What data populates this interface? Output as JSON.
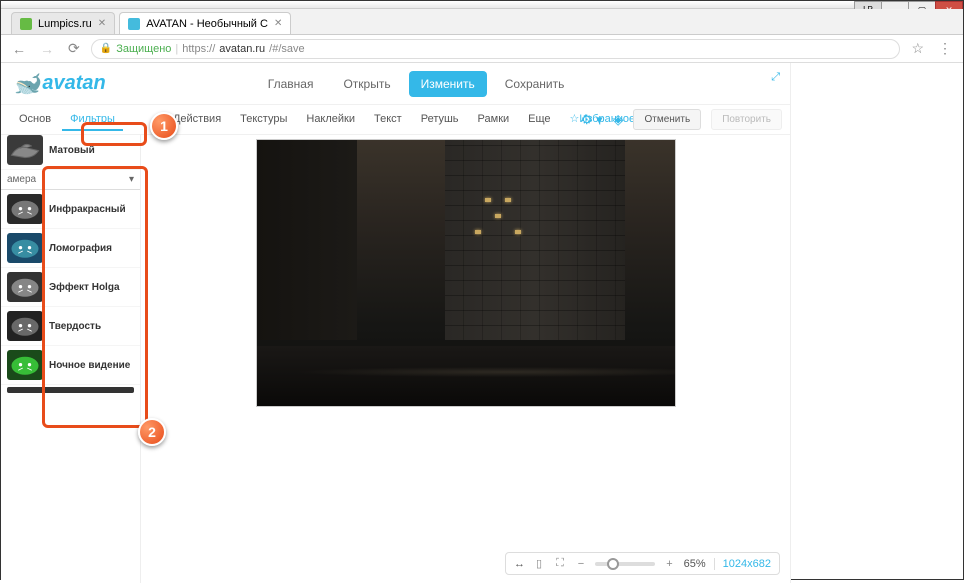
{
  "window": {
    "lp_badge": "LP"
  },
  "tabs": [
    {
      "title": "Lumpics.ru",
      "active": false
    },
    {
      "title": "AVATAN - Необычный С",
      "active": true
    }
  ],
  "address": {
    "secure_label": "Защищено",
    "url_prefix": "https://",
    "url_host": "avatan.ru",
    "url_path": "/#/save"
  },
  "logo": "avatan",
  "main_nav": {
    "home": "Главная",
    "open": "Открыть",
    "edit": "Изменить",
    "save": "Сохранить"
  },
  "toolbar": {
    "basic": "Основ",
    "filters": "Фильтры",
    "actions": "Действия",
    "textures": "Текстуры",
    "stickers": "Наклейки",
    "text": "Текст",
    "retouch": "Ретушь",
    "frames": "Рамки",
    "more": "Еще",
    "favorites": "Избранное",
    "undo": "Отменить",
    "redo": "Повторить"
  },
  "sidebar": {
    "category": "амера",
    "filters": [
      {
        "label": "Матовый",
        "bg": "#3a3a3a",
        "tint": "#888"
      },
      {
        "label": "Инфракрасный",
        "bg": "#2a2a2a",
        "tint": "#999"
      },
      {
        "label": "Ломография",
        "bg": "#1a4a6a",
        "tint": "#4ab"
      },
      {
        "label": "Эффект Holga",
        "bg": "#333",
        "tint": "#aaa"
      },
      {
        "label": "Твердость",
        "bg": "#222",
        "tint": "#888"
      },
      {
        "label": "Ночное видение",
        "bg": "#1a4a1a",
        "tint": "#4e4"
      }
    ]
  },
  "zoom": {
    "percent": "65%",
    "dimensions": "1024x682"
  },
  "annotations": {
    "one": "1",
    "two": "2"
  }
}
